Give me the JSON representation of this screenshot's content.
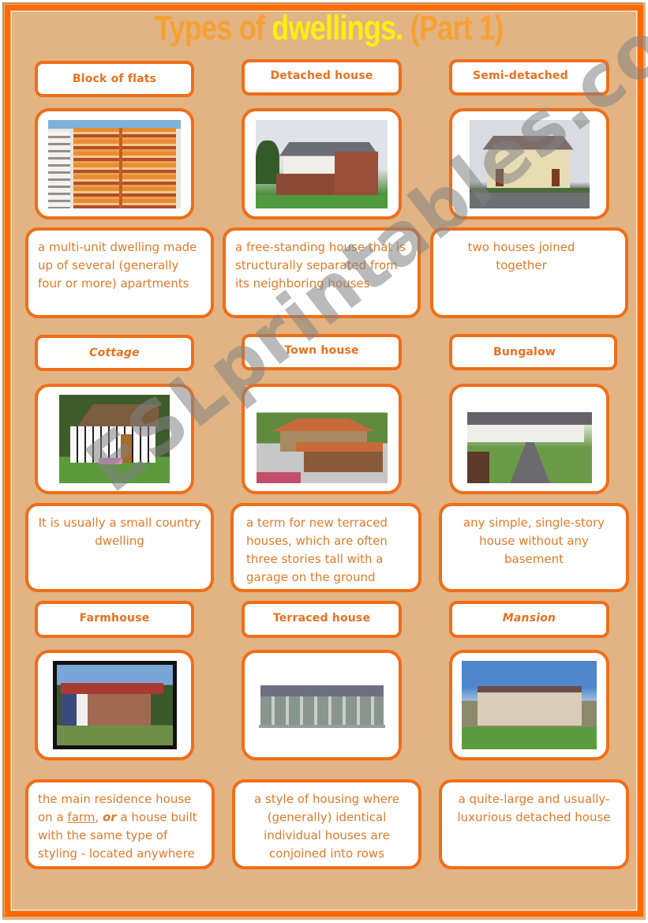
{
  "title": {
    "part1": "Types of ",
    "part2": "dwellings.",
    "part3": " (Part 1)"
  },
  "watermark": "ESLprintables.com",
  "cards": [
    {
      "label": "Block of flats",
      "image": "block-of-flats-photo",
      "description": "a multi-unit dwelling made up of several (generally four or more) apartments"
    },
    {
      "label": "Detached house",
      "image": "detached-house-photo",
      "description": "a free-standing house that is structurally separated from its neighboring houses"
    },
    {
      "label": "Semi-detached",
      "image": "semi-detached-photo",
      "description": "two houses joined together"
    },
    {
      "label": "Cottage",
      "image": "cottage-photo",
      "description": "It is usually a small country dwelling"
    },
    {
      "label": "Town house",
      "image": "town-house-photo",
      "description": "a term for new terraced houses, which are often three stories tall with a garage on the ground"
    },
    {
      "label": "Bungalow",
      "image": "bungalow-photo",
      "description": "any simple, single-story house without any basement"
    },
    {
      "label": "Farmhouse",
      "image": "farmhouse-photo",
      "description_parts": {
        "a": "the main residence house on a ",
        "link": "farm",
        "b": ", ",
        "em": "or",
        "c": " a house built with the same type of styling - located anywhere"
      }
    },
    {
      "label": "Terraced house",
      "image": "terraced-house-photo",
      "description": "a style of housing where (generally) identical individual houses are conjoined into rows"
    },
    {
      "label": "Mansion",
      "image": "mansion-photo",
      "description": "a quite-large and usually-luxurious detached house"
    }
  ],
  "colors": {
    "accent": "#ee6e1a",
    "background": "#e2b383",
    "text": "#e07b2a",
    "title_orange": "#f6a033",
    "title_yellow": "#ffee10"
  }
}
